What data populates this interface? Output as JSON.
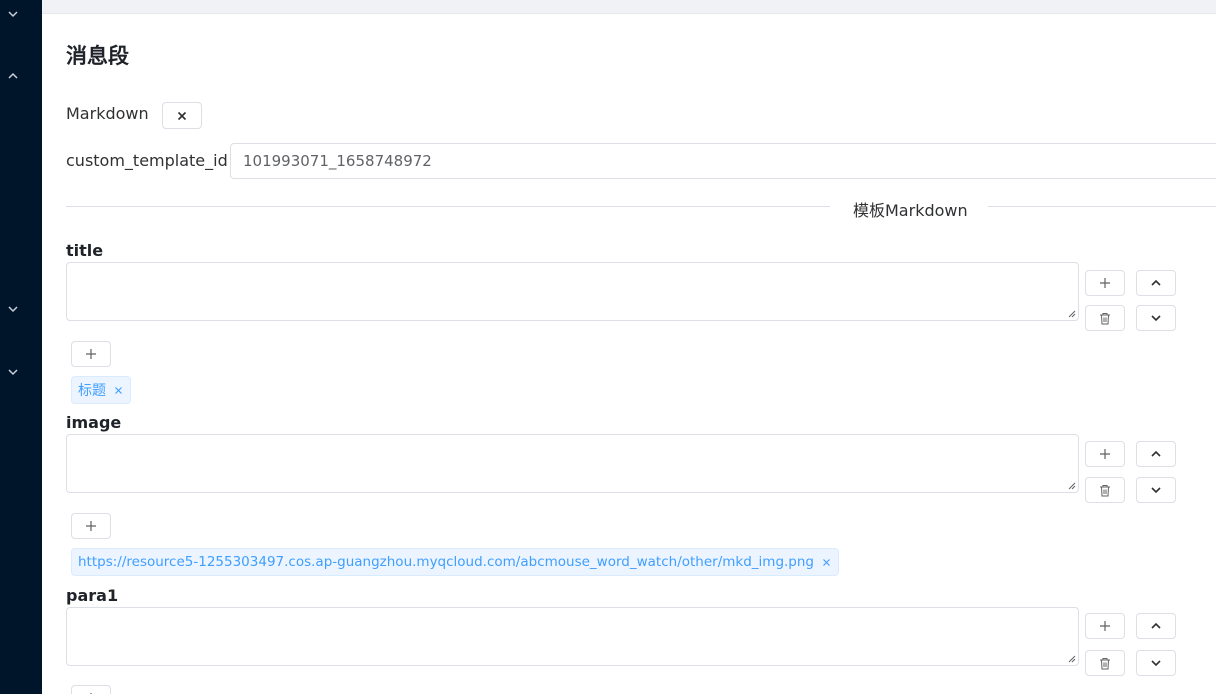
{
  "page": {
    "title": "消息段"
  },
  "form": {
    "markdown_label": "Markdown",
    "markdown_clear_icon": "close-icon",
    "custom_template_id_label": "custom_template_id",
    "custom_template_id_value": "101993071_1658748972"
  },
  "divider": {
    "text": "模板Markdown"
  },
  "fields": [
    {
      "label": "title",
      "tags": [
        "标题"
      ]
    },
    {
      "label": "image",
      "tags": [
        "https://resource5-1255303497.cos.ap-guangzhou.myqcloud.com/abcmouse_word_watch/other/mkd_img.png"
      ]
    },
    {
      "label": "para1",
      "tags": []
    }
  ],
  "icons": {
    "add": "plus-icon",
    "delete": "trash-icon",
    "move_up": "chevron-up-icon",
    "move_down": "chevron-down-icon",
    "tag_close": "close-icon",
    "sidebar": "chevron-down-icon"
  },
  "colors": {
    "sidebar_bg": "#001529",
    "tag_text": "#409eff",
    "tag_bg": "#ecf5ff",
    "border": "#dcdfe6"
  }
}
